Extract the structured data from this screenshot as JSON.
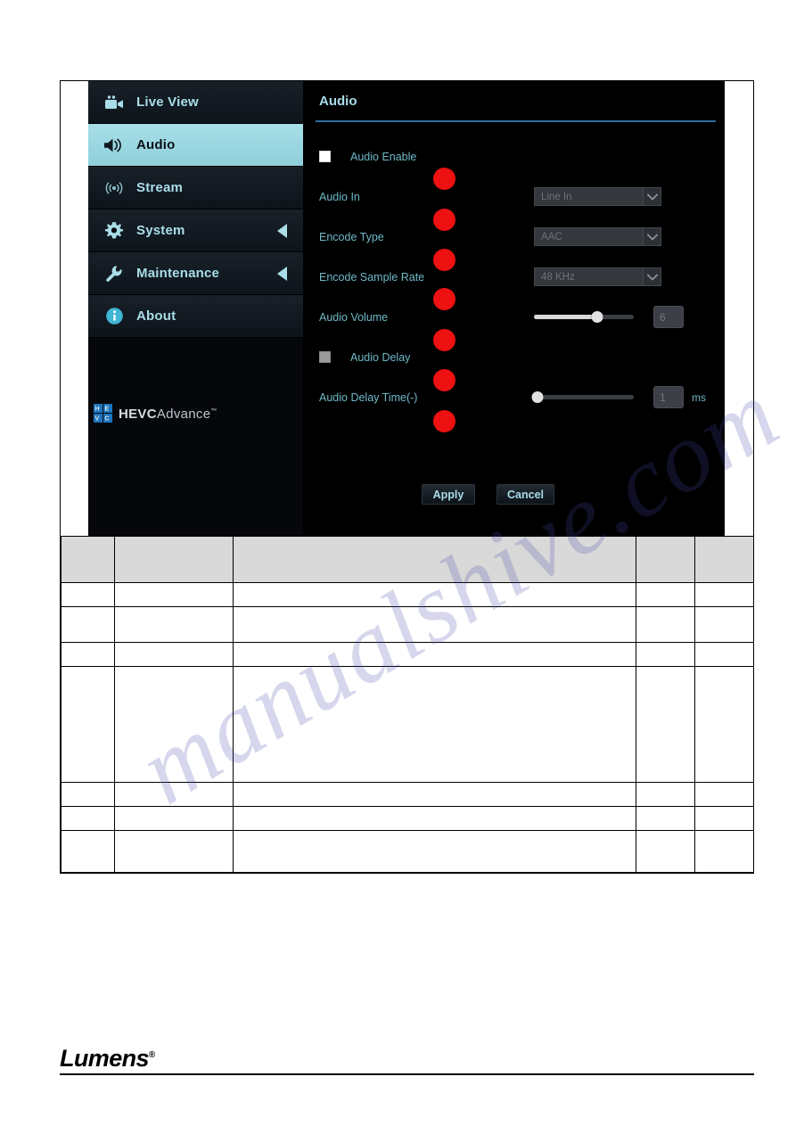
{
  "sidebar": {
    "items": [
      {
        "label": "Live View",
        "icon": "video-camera-icon",
        "active": false,
        "arrow": false
      },
      {
        "label": "Audio",
        "icon": "speaker-icon",
        "active": true,
        "arrow": false
      },
      {
        "label": "Stream",
        "icon": "broadcast-icon",
        "active": false,
        "arrow": false
      },
      {
        "label": "System",
        "icon": "gear-icon",
        "active": false,
        "arrow": true
      },
      {
        "label": "Maintenance",
        "icon": "wrench-icon",
        "active": false,
        "arrow": true
      },
      {
        "label": "About",
        "icon": "info-icon",
        "active": false,
        "arrow": false
      }
    ],
    "logo": {
      "primary": "HEVC",
      "secondary": "Advance",
      "trademark": "™"
    }
  },
  "content": {
    "title": "Audio",
    "rows": {
      "audio_enable": {
        "label": "Audio Enable",
        "checkbox": "checked"
      },
      "audio_in": {
        "label": "Audio In",
        "value": "Line In"
      },
      "encode_type": {
        "label": "Encode Type",
        "value": "AAC"
      },
      "encode_sample_rate": {
        "label": "Encode Sample Rate",
        "value": "48 KHz"
      },
      "audio_volume": {
        "label": "Audio Volume",
        "value": "6",
        "slider_percent": 63
      },
      "audio_delay": {
        "label": "Audio Delay",
        "checkbox": "unchecked"
      },
      "audio_delay_time": {
        "label": "Audio Delay Time(-)",
        "value": "1",
        "unit": "ms",
        "slider_percent": 0
      }
    },
    "buttons": {
      "apply": "Apply",
      "cancel": "Cancel"
    }
  },
  "colors": {
    "accent_cyan": "#a9dde8",
    "label_cyan": "#6fb9c9",
    "annotation_red": "#ee1111",
    "title_rule_blue": "#2f6f9e",
    "active_nav": "#8ecfdb"
  },
  "table": {
    "column_count": 5,
    "header_cells": [
      "",
      "",
      "",
      "",
      ""
    ],
    "rows": [
      [
        "",
        "",
        "",
        "",
        ""
      ],
      [
        "",
        "",
        "",
        "",
        ""
      ],
      [
        "",
        "",
        "",
        "",
        ""
      ],
      [
        "",
        "",
        "",
        "",
        ""
      ],
      [
        "",
        "",
        "",
        "",
        ""
      ],
      [
        "",
        "",
        "",
        "",
        ""
      ],
      [
        "",
        "",
        "",
        "",
        ""
      ]
    ]
  },
  "footer": {
    "brand": "Lumens",
    "trademark": "®"
  },
  "watermark": {
    "text": "manualshive.com"
  }
}
